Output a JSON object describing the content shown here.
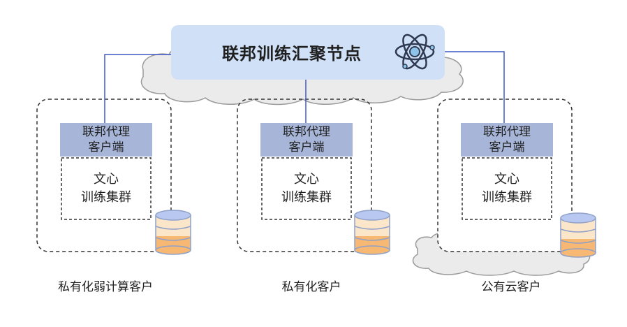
{
  "hub": {
    "title": "联邦训练汇聚节点",
    "icon": "atom-icon"
  },
  "nodes": [
    {
      "agent_line1": "联邦代理",
      "agent_line2": "客户端",
      "cluster_line1": "文心",
      "cluster_line2": "训练集群",
      "caption": "私有化弱计算客户"
    },
    {
      "agent_line1": "联邦代理",
      "agent_line2": "客户端",
      "cluster_line1": "文心",
      "cluster_line2": "训练集群",
      "caption": "私有化客户"
    },
    {
      "agent_line1": "联邦代理",
      "agent_line2": "客户端",
      "cluster_line1": "文心",
      "cluster_line2": "训练集群",
      "caption": "公有云客户"
    }
  ],
  "colors": {
    "hub_fill": "#cfe0f7",
    "agent_fill": "#a7b6d8",
    "cloud_fill": "#ebebeb",
    "line": "#3f58c6",
    "db_top": "#b9c8f0",
    "db_cream": "#fbe6c9",
    "db_orange": "#f6b873"
  }
}
